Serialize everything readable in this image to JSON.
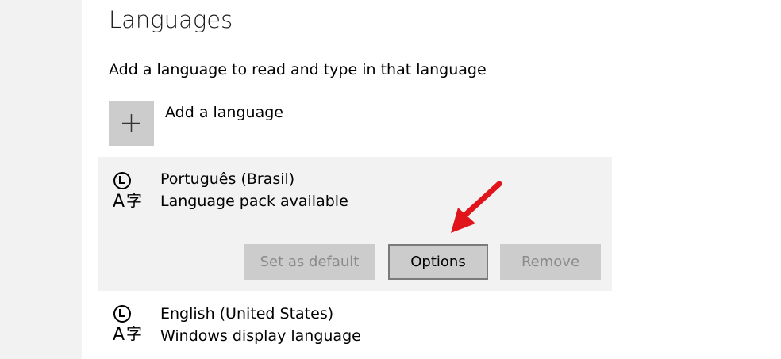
{
  "page": {
    "title": "Languages",
    "subtitle": "Add a language to read and type in that language"
  },
  "add_language": {
    "label": "Add a language",
    "icon": "plus-icon"
  },
  "languages": [
    {
      "name": "Português (Brasil)",
      "status": "Language pack available",
      "icon": "language-icon",
      "selected": true,
      "buttons": {
        "set_default": "Set as default",
        "options": "Options",
        "remove": "Remove"
      }
    },
    {
      "name": "English (United States)",
      "status": "Windows display language",
      "icon": "language-icon",
      "selected": false
    }
  ],
  "colors": {
    "sidebar_bg": "#f2f2f2",
    "selected_item_bg": "#f2f2f2",
    "tile_bg": "#cccccc",
    "disabled_text": "#8a8a8a",
    "annotation_arrow": "#e0141a"
  },
  "annotation": {
    "icon": "red-arrow-icon"
  }
}
